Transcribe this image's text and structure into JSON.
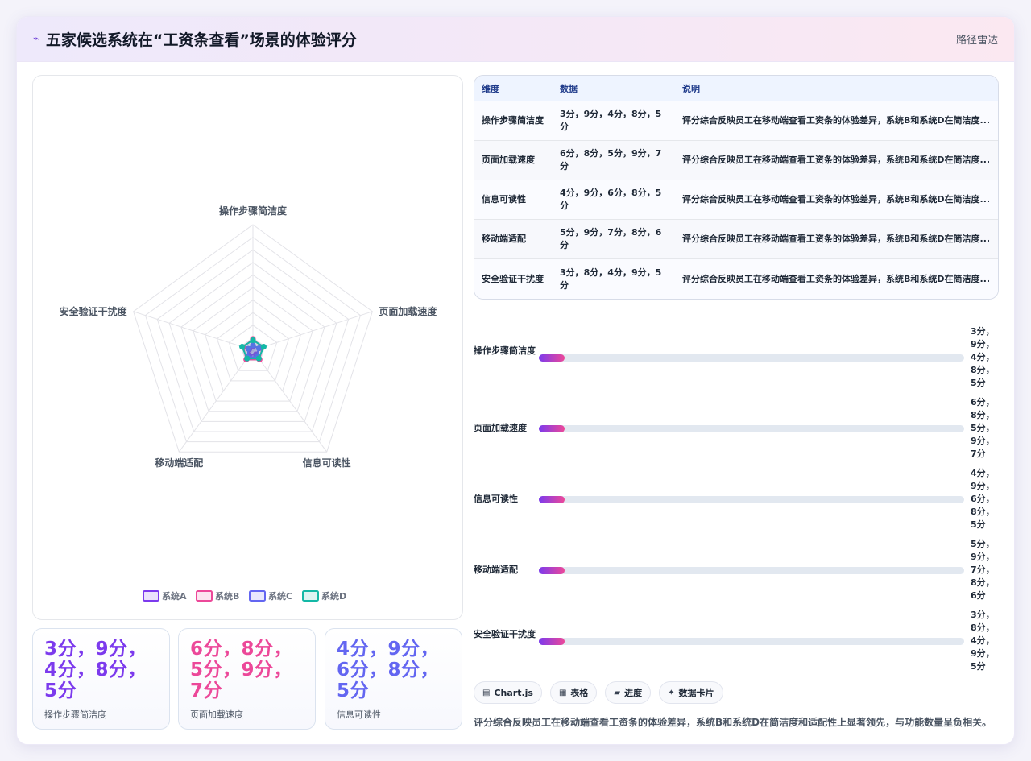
{
  "header": {
    "title": "五家候选系统在“工资条查看”场景的体验评分",
    "right_label": "路径雷达"
  },
  "chart_data": {
    "type": "radar",
    "title": "",
    "axes": [
      "操作步骤简洁度",
      "页面加载速度",
      "信息可读性",
      "移动端适配",
      "安全验证干扰度"
    ],
    "rmax": 100,
    "rings": 10,
    "series": [
      {
        "name": "系统A",
        "color": "#7c3aed",
        "values": [
          3,
          6,
          4,
          5,
          3
        ]
      },
      {
        "name": "系统B",
        "color": "#ec4899",
        "values": [
          9,
          8,
          9,
          9,
          8
        ]
      },
      {
        "name": "系统C",
        "color": "#6366f1",
        "values": [
          4,
          5,
          6,
          7,
          4
        ]
      },
      {
        "name": "系统D",
        "color": "#14b8a6",
        "values": [
          8,
          9,
          8,
          8,
          9
        ]
      }
    ],
    "legend_position": "bottom"
  },
  "table": {
    "headers": [
      "维度",
      "数据",
      "说明"
    ],
    "rows": [
      {
        "dim": "操作步骤简洁度",
        "val": "3分，9分，4分，8分，5分",
        "desc": "评分综合反映员工在移动端查看工资条的体验差异，系统B和系统D在简洁度..."
      },
      {
        "dim": "页面加载速度",
        "val": "6分，8分，5分，9分，7分",
        "desc": "评分综合反映员工在移动端查看工资条的体验差异，系统B和系统D在简洁度..."
      },
      {
        "dim": "信息可读性",
        "val": "4分，9分，6分，8分，5分",
        "desc": "评分综合反映员工在移动端查看工资条的体验差异，系统B和系统D在简洁度..."
      },
      {
        "dim": "移动端适配",
        "val": "5分，9分，7分，8分，6分",
        "desc": "评分综合反映员工在移动端查看工资条的体验差异，系统B和系统D在简洁度..."
      },
      {
        "dim": "安全验证干扰度",
        "val": "3分，8分，4分，9分，5分",
        "desc": "评分综合反映员工在移动端查看工资条的体验差异，系统B和系统D在简洁度..."
      }
    ]
  },
  "progress": [
    {
      "label": "操作步骤简洁度",
      "value_lines": [
        "3分，",
        "9分，",
        "4分，",
        "8分，",
        "5分"
      ],
      "fraction": 0.06
    },
    {
      "label": "页面加载速度",
      "value_lines": [
        "6分，",
        "8分，",
        "5分，",
        "9分，",
        "7分"
      ],
      "fraction": 0.06
    },
    {
      "label": "信息可读性",
      "value_lines": [
        "4分，",
        "9分，",
        "6分，",
        "8分，",
        "5分"
      ],
      "fraction": 0.06
    },
    {
      "label": "移动端适配",
      "value_lines": [
        "5分，",
        "9分，",
        "7分，",
        "8分，",
        "6分"
      ],
      "fraction": 0.06
    },
    {
      "label": "安全验证干扰度",
      "value_lines": [
        "3分，",
        "8分，",
        "4分，",
        "9分，",
        "5分"
      ],
      "fraction": 0.06
    }
  ],
  "kpis": [
    {
      "lines": [
        "3分，9分，",
        "4分，8分，",
        "5分"
      ],
      "label": "操作步骤简洁度",
      "color": "#7c3aed"
    },
    {
      "lines": [
        "6分，8分，",
        "5分，9分，",
        "7分"
      ],
      "label": "页面加载速度",
      "color": "#ec4899"
    },
    {
      "lines": [
        "4分，9分，",
        "6分，8分，",
        "5分"
      ],
      "label": "信息可读性",
      "color": "#6366f1"
    }
  ],
  "chips": [
    {
      "icon": "chart-icon",
      "glyph": "▤",
      "label": "Chart.js"
    },
    {
      "icon": "table-icon",
      "glyph": "▦",
      "label": "表格"
    },
    {
      "icon": "progress-icon",
      "glyph": "▰",
      "label": "进度"
    },
    {
      "icon": "card-icon",
      "glyph": "✦",
      "label": "数据卡片"
    }
  ],
  "note": "评分综合反映员工在移动端查看工资条的体验差异，系统B和系统D在简洁度和适配性上显著领先，与功能数量呈负相关。"
}
